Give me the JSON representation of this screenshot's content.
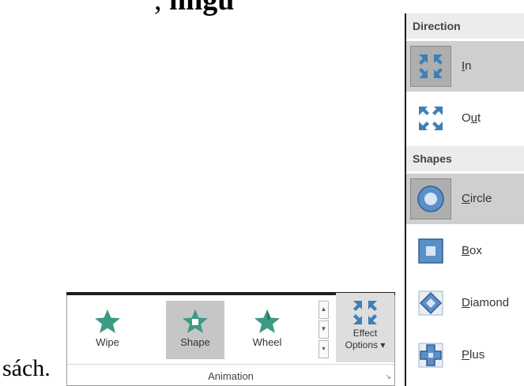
{
  "document": {
    "top_text_start": ", ",
    "top_text_bold": "n",
    "top_text_end": "ngữ",
    "bottom_text": "sách."
  },
  "ribbon": {
    "gallery": [
      {
        "label": "Wipe",
        "icon": "star-icon",
        "selected": false
      },
      {
        "label": "Shape",
        "icon": "star-shape-icon",
        "selected": true
      },
      {
        "label": "Wheel",
        "icon": "star-wheel-icon",
        "selected": false
      }
    ],
    "effect_options": {
      "line1": "Effect",
      "line2": "Options ▾"
    },
    "group_label": "Animation",
    "launcher_glyph": "↘"
  },
  "menu": {
    "sections": [
      {
        "header": "Direction",
        "items": [
          {
            "label_underlined": "I",
            "label_rest": "n",
            "icon": "arrows-in-icon",
            "selected": true
          },
          {
            "label_pre": "O",
            "label_underlined": "u",
            "label_rest": "t",
            "icon": "arrows-out-icon",
            "selected": false
          }
        ]
      },
      {
        "header": "Shapes",
        "items": [
          {
            "label_underlined": "C",
            "label_rest": "ircle",
            "icon": "circle-shape-icon",
            "selected": true
          },
          {
            "label_underlined": "B",
            "label_rest": "ox",
            "icon": "box-shape-icon",
            "selected": false
          },
          {
            "label_underlined": "D",
            "label_rest": "iamond",
            "icon": "diamond-shape-icon",
            "selected": false
          },
          {
            "label_underlined": "P",
            "label_rest": "lus",
            "icon": "plus-shape-icon",
            "selected": false
          }
        ]
      }
    ]
  },
  "colors": {
    "star_teal": "#3e9a84",
    "arrow_blue": "#3f7fb5",
    "selected_bg": "#c6c6c6"
  }
}
